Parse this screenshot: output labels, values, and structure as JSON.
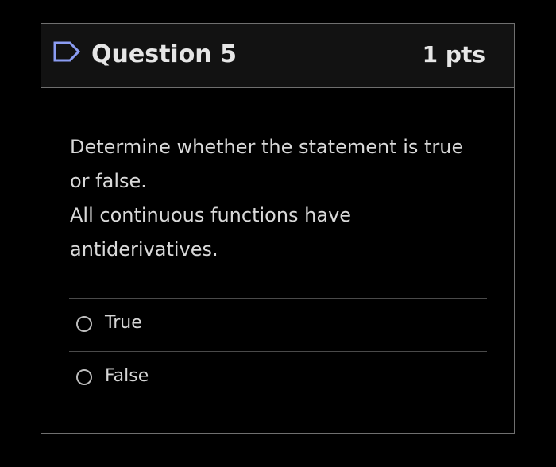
{
  "question": {
    "title": "Question 5",
    "points": "1 pts",
    "flag_icon": "flag-outline-icon",
    "text_lines": [
      "Determine whether the statement is true",
      "or false.",
      "All continuous functions have",
      "antiderivatives."
    ]
  },
  "answers": [
    {
      "label": "True",
      "selected": false
    },
    {
      "label": "False",
      "selected": false
    }
  ],
  "colors": {
    "background": "#000000",
    "header_background": "#121212",
    "border": "#6f6f6f",
    "text": "#e6e6e6",
    "flag": "#8b9cf2"
  }
}
